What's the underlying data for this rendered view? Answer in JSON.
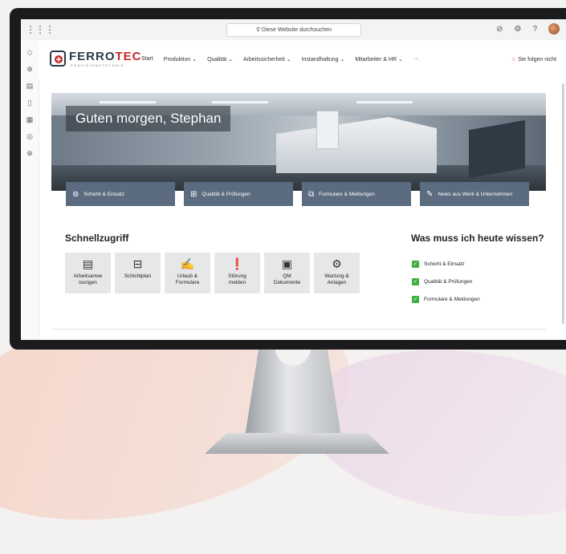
{
  "topbar": {
    "search_placeholder": "Diese Website durchsuchen",
    "icons": [
      "waffle-icon",
      "search-icon",
      "help-chat-icon",
      "settings-icon",
      "help-icon",
      "avatar"
    ]
  },
  "rail": [
    "home-icon",
    "globe-icon",
    "news-icon",
    "files-icon",
    "lists-icon",
    "pages-icon",
    "add-icon"
  ],
  "brand": {
    "name_part1": "FERRO",
    "name_part2": "TEC",
    "subtitle": "PRÄZISIONSTECHNIK",
    "accent": "#c62828"
  },
  "nav": {
    "items": [
      "Start",
      "Produktion ⌄",
      "Qualität ⌄",
      "Arbeitssicherheit ⌄",
      "Instandhaltung ⌄",
      "Mitarbeiter & HR ⌄",
      "···"
    ],
    "follow_label": "Sie folgen nicht"
  },
  "hero": {
    "greeting": "Guten morgen, Stephan",
    "tiles": [
      {
        "label": "Schicht & Einsatz",
        "icon": "compass-icon"
      },
      {
        "label": "Qualität & Prüfungen",
        "icon": "chart-icon"
      },
      {
        "label": "Formulare & Meldungen",
        "icon": "forms-icon"
      },
      {
        "label": "News aus Werk & Unternehmen",
        "icon": "news-icon"
      }
    ]
  },
  "quick_access": {
    "title": "Schnellzugriff",
    "items": [
      {
        "label": "Arbeitsanwe\nisungen",
        "icon": "document-icon"
      },
      {
        "label": "Schichtplan",
        "icon": "presentation-icon"
      },
      {
        "label": "Urlaub &\nFormulare",
        "icon": "signature-icon"
      },
      {
        "label": "Störung\nmelden",
        "icon": "alert-icon"
      },
      {
        "label": "QM\nDokumente",
        "icon": "qm-icon"
      },
      {
        "label": "Wartung &\nAnlagen",
        "icon": "conveyor-icon"
      }
    ]
  },
  "today": {
    "title": "Was muss ich heute wissen?",
    "items": [
      "Schicht & Einsatz",
      "Qualität & Prüfungen",
      "Formulare & Meldungen"
    ],
    "check_color": "#3fae3f"
  }
}
